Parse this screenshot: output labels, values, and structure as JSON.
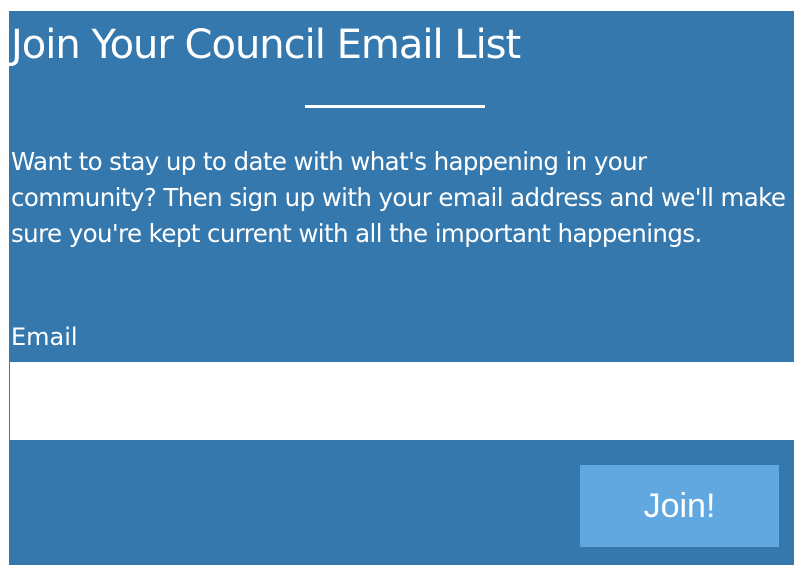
{
  "signup": {
    "title": "Join Your Council Email List",
    "description": "Want to stay up to date with what's happening in your community? Then sign up with your email address and we'll make sure you're kept current with all the important happenings.",
    "email_label": "Email",
    "email_value": "",
    "email_placeholder": "",
    "submit_label": "Join!"
  },
  "colors": {
    "panel_background": "#3478ae",
    "button_background": "#62a8e0",
    "text": "#ffffff"
  }
}
